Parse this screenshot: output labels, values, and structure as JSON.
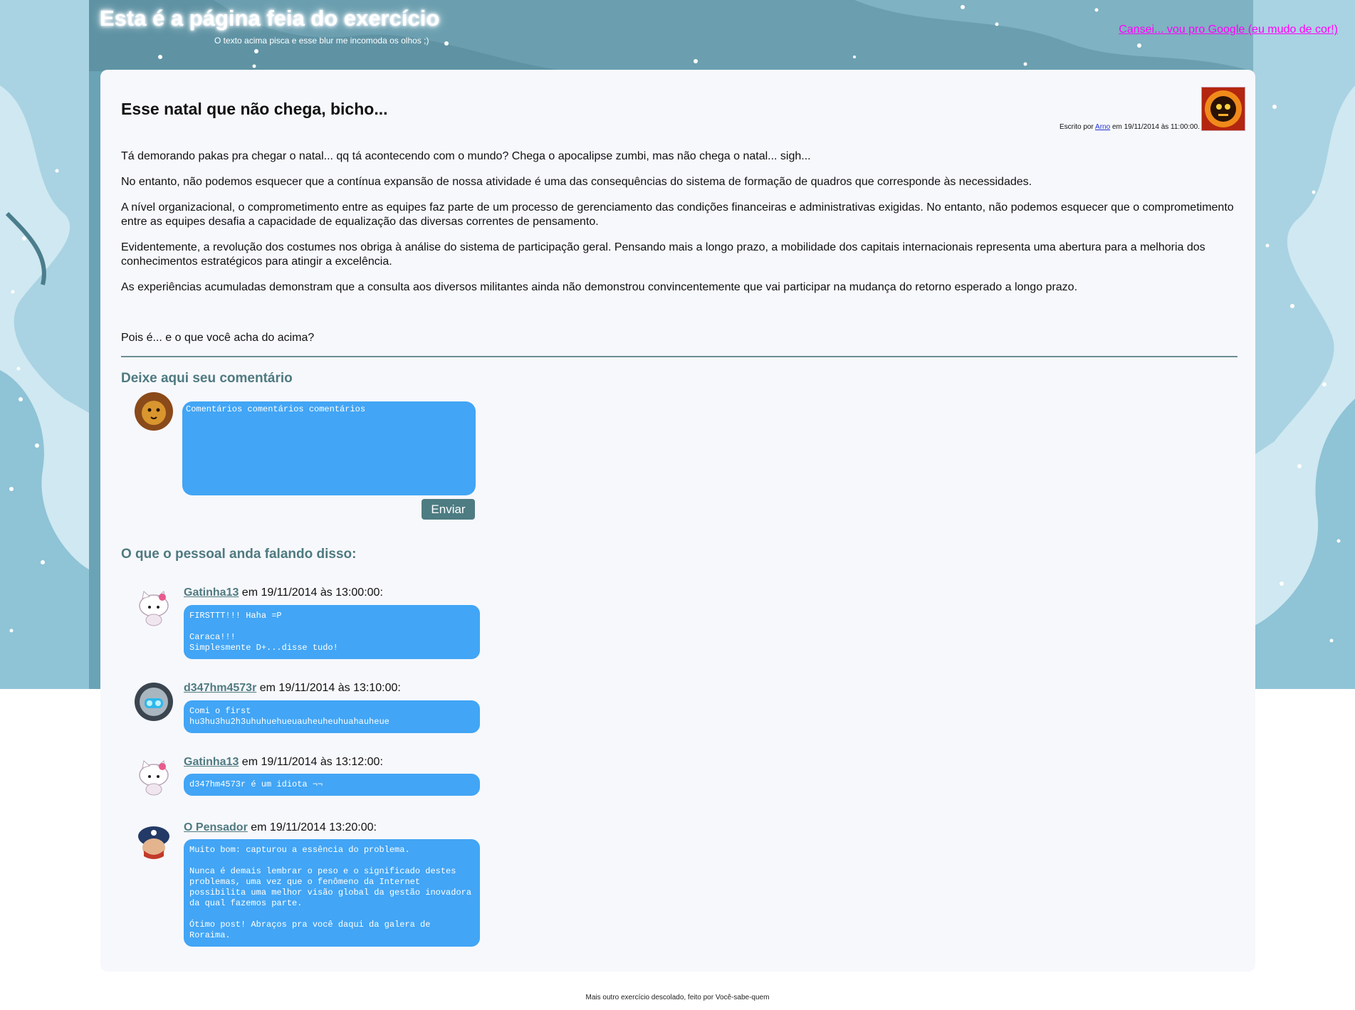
{
  "header": {
    "title": "Esta é a página feia do exercício",
    "subtitle": "O texto acima pisca e esse blur me incomoda os olhos ;)",
    "google_link": "Cansei... vou pro Google (eu mudo de cor!)"
  },
  "post": {
    "title": "Esse natal que não chega, bicho...",
    "byline_prefix": "Escrito por",
    "author": "Arno",
    "byline_suffix": "em 19/11/2014 às 11:00:00.",
    "paragraphs": [
      "Tá demorando pakas pra chegar o natal... qq tá acontecendo com o mundo? Chega o apocalipse zumbi, mas não chega o natal... sigh...",
      "No entanto, não podemos esquecer que a contínua expansão de nossa atividade é uma das consequências do sistema de formação de quadros que corresponde às necessidades.",
      "A nível organizacional, o comprometimento entre as equipes faz parte de um processo de gerenciamento das condições financeiras e administrativas exigidas. No entanto, não podemos esquecer que o comprometimento entre as equipes desafia a capacidade de equalização das diversas correntes de pensamento.",
      "Evidentemente, a revolução dos costumes nos obriga à análise do sistema de participação geral. Pensando mais a longo prazo, a mobilidade dos capitais internacionais representa uma abertura para a melhoria dos conhecimentos estratégicos para atingir a excelência.",
      "As experiências acumuladas demonstram que a consulta aos diversos militantes ainda não demonstrou convincentemente que vai participar na mudança do retorno esperado a longo prazo."
    ],
    "question": "Pois é... e o que você acha do acima?"
  },
  "comment_form": {
    "heading": "Deixe aqui seu comentário",
    "placeholder": "Comentários comentários comentários",
    "send_label": "Enviar"
  },
  "comments_section": {
    "heading": "O que o pessoal anda falando disso:",
    "comments": [
      {
        "author": "Gatinha13",
        "meta": " em 19/11/2014 às 13:00:00:",
        "avatar": "hello-kitty-avatar",
        "text": "FIRSTTT!!! Haha =P\n\nCaraca!!!\nSimplesmente D+...disse tudo!"
      },
      {
        "author": "d347hm4573r",
        "meta": " em 19/11/2014 às 13:10:00:",
        "avatar": "robot-avatar",
        "text": "Comi o first\nhu3hu3hu2h3uhuhuehueuauheuheuhuahauheue"
      },
      {
        "author": "Gatinha13",
        "meta": " em 19/11/2014 às 13:12:00:",
        "avatar": "hello-kitty-avatar",
        "text": "d347hm4573r é um idiota ¬¬"
      },
      {
        "author": "O Pensador",
        "meta": " em 19/11/2014 13:20:00:",
        "avatar": "captain-avatar",
        "text": "Muito bom: capturou a essência do problema.\n\nNunca é demais lembrar o peso e o significado destes problemas, uma vez que o fenômeno da Internet possibilita uma melhor visão global da gestão inovadora da qual fazemos parte.\n\nÓtimo post! Abraços pra você daqui da galera de Roraima."
      }
    ]
  },
  "footer": {
    "text": "Mais outro exercício descolado, feito por Você-sabe-quem"
  },
  "colors": {
    "accent": "#42a5f5",
    "heading": "#4e7a80",
    "link_visited": "#ff00ff",
    "card_bg": "#f7f8fc"
  }
}
